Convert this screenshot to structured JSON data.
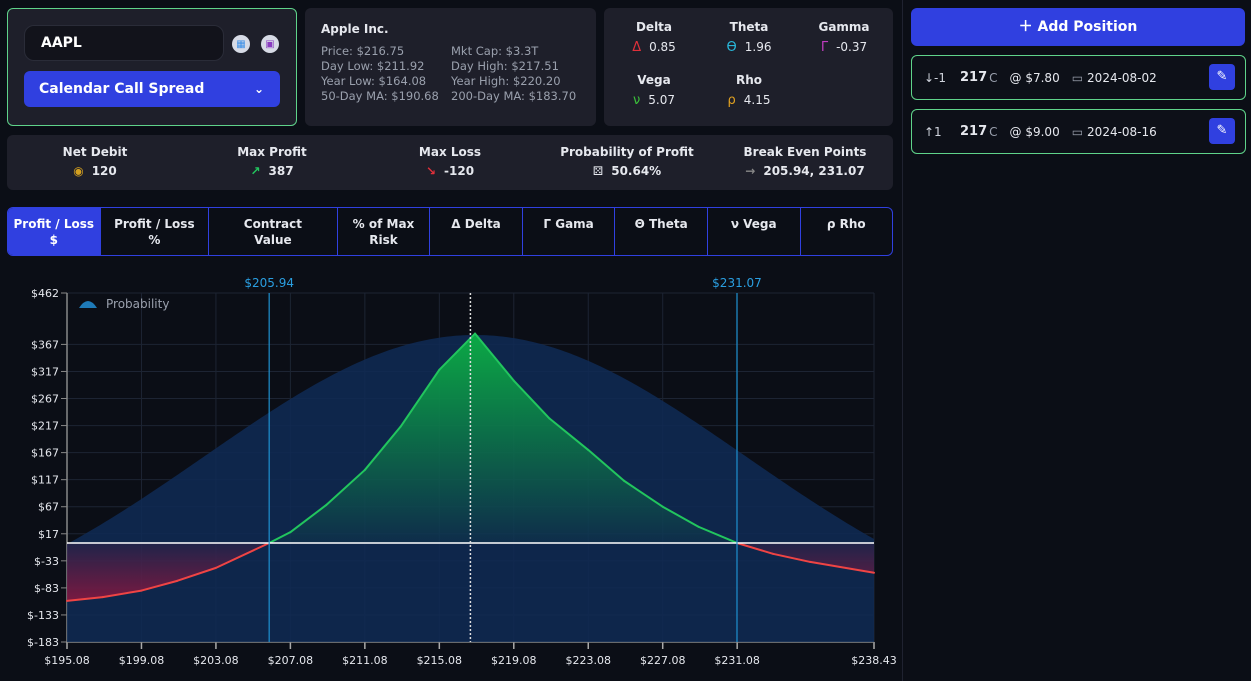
{
  "ticker": {
    "symbol": "AAPL",
    "strategy": "Calendar Call Spread",
    "icons": [
      "calendar-icon",
      "screenshot-icon"
    ]
  },
  "company": {
    "name": "Apple Inc.",
    "price": "Price: $216.75",
    "mkt_cap": "Mkt Cap: $3.3T",
    "day_low": "Day Low: $211.92",
    "day_high": "Day High: $217.51",
    "year_low": "Year Low: $164.08",
    "year_high": "Year High: $220.20",
    "ma50": "50-Day MA: $190.68",
    "ma200": "200-Day MA: $183.70"
  },
  "greeks": [
    {
      "label": "Delta",
      "symbol": "Δ",
      "value": "0.85",
      "color": "#e0303a"
    },
    {
      "label": "Theta",
      "symbol": "ϴ",
      "value": "1.96",
      "color": "#29b6d8"
    },
    {
      "label": "Gamma",
      "symbol": "Γ",
      "value": "-0.37",
      "color": "#c03cc0"
    },
    {
      "label": "Vega",
      "symbol": "ν",
      "value": "5.07",
      "color": "#3bbf3b"
    },
    {
      "label": "Rho",
      "symbol": "ρ",
      "value": "4.15",
      "color": "#e0a020"
    }
  ],
  "stats": [
    {
      "label": "Net Debit",
      "icon": "coins-icon",
      "value": "120",
      "color": "#d4a020"
    },
    {
      "label": "Max Profit",
      "icon": "arrow-up-right-icon",
      "glyph": "↗",
      "value": "387",
      "color": "#22c55e"
    },
    {
      "label": "Max Loss",
      "icon": "arrow-down-right-icon",
      "glyph": "↘",
      "value": "-120",
      "color": "#e0303a"
    },
    {
      "label": "Probability of Profit",
      "icon": "dice-icon",
      "glyph": "⚄",
      "value": "50.64%",
      "color": "#ffffff"
    },
    {
      "label": "Break Even Points",
      "icon": "arrow-right-icon",
      "glyph": "→",
      "value": "205.94, 231.07",
      "color": "#888888"
    }
  ],
  "tabs": [
    {
      "label": "Profit / Loss $",
      "active": true
    },
    {
      "label": "Profit / Loss %"
    },
    {
      "label": "Contract Value"
    },
    {
      "label": "% of Max Risk"
    },
    {
      "label": "Δ Delta"
    },
    {
      "label": "Γ Gama"
    },
    {
      "label": "Θ Theta"
    },
    {
      "label": "ν Vega"
    },
    {
      "label": "ρ Rho"
    }
  ],
  "sidebar": {
    "add_position": "Add Position",
    "positions": [
      {
        "qty": "↓-1",
        "strike": "217",
        "type": "C",
        "price": "@ $7.80",
        "date": "2024-08-02"
      },
      {
        "qty": "↑1",
        "strike": "217",
        "type": "C",
        "price": "@ $9.00",
        "date": "2024-08-16"
      }
    ]
  },
  "chart_data": {
    "type": "line",
    "legend": {
      "label": "Probability",
      "position": "top-left"
    },
    "xlim": [
      195.08,
      238.43
    ],
    "ylim": [
      -183,
      462
    ],
    "x_ticks": [
      "$195.08",
      "$199.08",
      "$203.08",
      "$207.08",
      "$211.08",
      "$215.08",
      "$219.08",
      "$223.08",
      "$227.08",
      "$231.08",
      "$238.43"
    ],
    "x_tick_values": [
      195.08,
      199.08,
      203.08,
      207.08,
      211.08,
      215.08,
      219.08,
      223.08,
      227.08,
      231.08,
      238.43
    ],
    "y_ticks": [
      "$462",
      "$367",
      "$317",
      "$267",
      "$217",
      "$167",
      "$117",
      "$67",
      "$17",
      "$-33",
      "$-83",
      "$-133",
      "$-183"
    ],
    "y_tick_values": [
      462,
      367,
      317,
      267,
      217,
      167,
      117,
      67,
      17,
      -33,
      -83,
      -133,
      -183
    ],
    "current_price": 216.75,
    "break_even": [
      {
        "value": 205.94,
        "label": "$205.94"
      },
      {
        "value": 231.07,
        "label": "$231.07"
      }
    ],
    "series": [
      {
        "x": [
          195.08,
          197,
          199.08,
          201,
          203.08,
          205.94,
          207.08,
          209,
          211.08,
          213,
          215.08,
          217,
          219.08,
          221,
          223.08,
          225,
          227.08,
          229,
          231.07,
          233,
          235,
          238.43
        ],
        "y": [
          -107,
          -100,
          -88,
          -70,
          -46,
          0,
          20,
          70,
          135,
          215,
          320,
          387,
          300,
          230,
          172,
          115,
          67,
          30,
          0,
          -20,
          -35,
          -55
        ]
      }
    ],
    "grid": true,
    "colors": {
      "profit": "#22c55e",
      "loss": "#ef4444",
      "probability": "#0f2a55",
      "break_even": "#1e90d0"
    }
  }
}
